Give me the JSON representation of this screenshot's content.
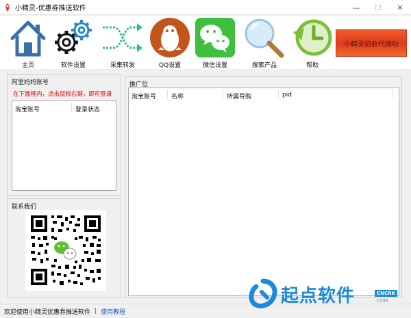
{
  "window": {
    "title": "小精灵-优惠券推送软件",
    "controls": [
      "—",
      "☐",
      "✕"
    ]
  },
  "toolbar": {
    "items": [
      {
        "label": "主页",
        "icon": "home-icon"
      },
      {
        "label": "软件设置",
        "icon": "gears-icon"
      },
      {
        "label": "采集转发",
        "icon": "shuffle-arrows-icon"
      },
      {
        "label": "QQ设置",
        "icon": "qq-penguin-icon"
      },
      {
        "label": "微信设置",
        "icon": "wechat-icon"
      },
      {
        "label": "搜索产品",
        "icon": "magnifier-icon"
      },
      {
        "label": "帮助",
        "icon": "help-clock-icon"
      }
    ],
    "banner": "小精灵招收代理啦"
  },
  "accounts": {
    "group_title": "阿里妈妈账号",
    "hint": "在下面框内，点击鼠标右键，即可登录",
    "columns": [
      "淘宝账号",
      "登录状态"
    ]
  },
  "contact": {
    "group_title": "联系我们"
  },
  "promo": {
    "group_title": "推广位",
    "columns": [
      "淘宝账号",
      "名称",
      "所属导购",
      "pid"
    ]
  },
  "status": {
    "text": "欢迎使用小精灵优惠券推送软件",
    "separator": "|",
    "link": "使用教程"
  },
  "watermark": {
    "text": "起点软件",
    "badge": "CNCRK",
    "sub": "COM"
  },
  "colors": {
    "banner": "#e8491f",
    "hint": "#e60000",
    "link": "#1a5ab8",
    "watermark": "#1f8ad8"
  }
}
